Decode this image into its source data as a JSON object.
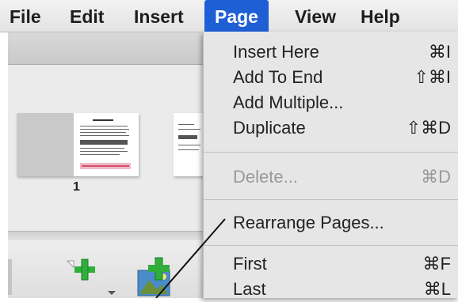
{
  "menubar": {
    "items": [
      "File",
      "Edit",
      "Insert",
      "Page",
      "View",
      "Help"
    ],
    "active": "Page",
    "active_color": "#1f5fd6"
  },
  "thumbnail": {
    "page_number": "1"
  },
  "page_menu": {
    "items": [
      {
        "label": "Insert Here",
        "shortcut": "⌘I",
        "enabled": true
      },
      {
        "label": "Add To End",
        "shortcut": "⇧⌘I",
        "enabled": true
      },
      {
        "label": "Add Multiple...",
        "shortcut": "",
        "enabled": true
      },
      {
        "label": "Duplicate",
        "shortcut": "⇧⌘D",
        "enabled": true
      },
      {
        "label": "Delete...",
        "shortcut": "⌘D",
        "enabled": false
      },
      {
        "label": "Rearrange Pages...",
        "shortcut": "",
        "enabled": true
      },
      {
        "label": "First",
        "shortcut": "⌘F",
        "enabled": true
      },
      {
        "label": "Last",
        "shortcut": "⌘L",
        "enabled": true
      }
    ]
  },
  "icons": [
    "add-page-icon",
    "insert-image-icon",
    "dropdown-arrow-icon"
  ]
}
